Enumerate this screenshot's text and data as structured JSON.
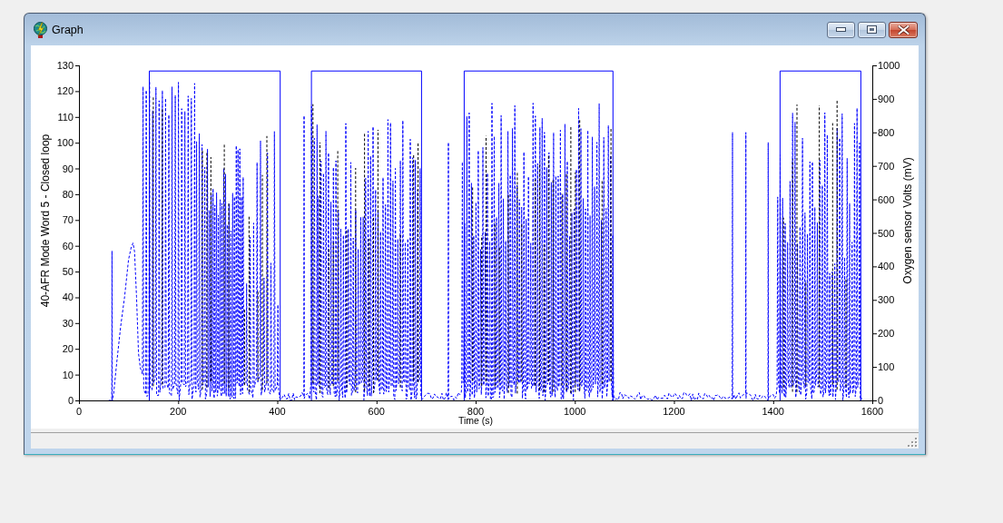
{
  "window": {
    "title": "Graph",
    "controls": [
      {
        "kind": "minimize"
      },
      {
        "kind": "maximize"
      },
      {
        "kind": "close"
      }
    ]
  },
  "graph": {
    "chart_data": {
      "type": "line",
      "xlabel": "Time (s)",
      "ylabel": "40-AFR Mode Word 5 - Closed loop",
      "x": [
        66,
        141,
        141,
        405,
        405,
        468,
        468,
        690,
        690,
        776,
        776,
        1076,
        1076,
        1413,
        1413,
        1576,
        1576,
        1580
      ],
      "series": [
        {
          "color": "#0000ff",
          "values": [
            0,
            0,
            128,
            128,
            0,
            0,
            128,
            128,
            0,
            0,
            128,
            128,
            0,
            0,
            128,
            128,
            0,
            0
          ]
        }
      ],
      "xlim": [
        0,
        1600
      ],
      "ylim": [
        0,
        130
      ],
      "xticks": [
        0,
        200,
        400,
        600,
        800,
        1000,
        1200,
        1400,
        1600
      ],
      "yticks": [
        0,
        10,
        20,
        30,
        40,
        50,
        60,
        70,
        80,
        90,
        100,
        110,
        120,
        130
      ]
    },
    "right_axis": {
      "label": "Oxygen sensor Volts (mV)",
      "ticks": [
        "1000",
        "900",
        "800",
        "700",
        "600",
        "500",
        "400",
        "300",
        "200",
        "100",
        "0"
      ]
    }
  }
}
